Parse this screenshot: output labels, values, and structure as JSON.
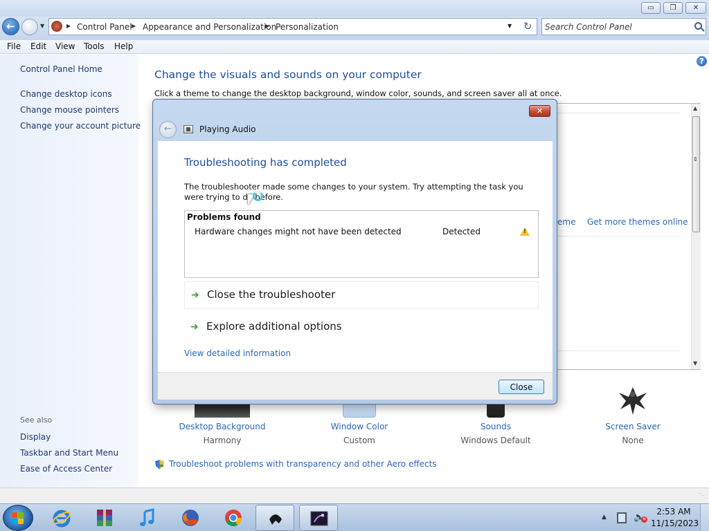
{
  "window": {
    "caption_buttons": {
      "minimize": "▭",
      "maximize": "❐",
      "close": "✕"
    }
  },
  "address": {
    "crumbs": [
      "Control Panel",
      "Appearance and Personalization",
      "Personalization"
    ],
    "search_placeholder": "Search Control Panel"
  },
  "menu": {
    "items": [
      "File",
      "Edit",
      "View",
      "Tools",
      "Help"
    ]
  },
  "left_pane": {
    "home": "Control Panel Home",
    "links": [
      "Change desktop icons",
      "Change mouse pointers",
      "Change your account picture"
    ],
    "see_also_label": "See also",
    "see_also": [
      "Display",
      "Taskbar and Start Menu",
      "Ease of Access Center"
    ]
  },
  "main": {
    "title": "Change the visuals and sounds on your computer",
    "subtitle": "Click a theme to change the desktop background, window color, sounds, and screen saver all at once.",
    "theme_link_partial": "eme",
    "get_more_themes": "Get more themes online",
    "bottom_items": [
      {
        "label": "Desktop Background",
        "value": "Harmony"
      },
      {
        "label": "Window Color",
        "value": "Custom"
      },
      {
        "label": "Sounds",
        "value": "Windows Default"
      },
      {
        "label": "Screen Saver",
        "value": "None"
      }
    ],
    "aero_link": "Troubleshoot problems with transparency and other Aero effects"
  },
  "dialog": {
    "title": "Playing Audio",
    "heading": "Troubleshooting has completed",
    "description": "The troubleshooter made some changes to your system. Try attempting the task you were trying to do before.",
    "problems_header": "Problems found",
    "problems": [
      {
        "name": "Hardware changes might not have been detected",
        "status": "Detected",
        "icon": "warning-icon"
      }
    ],
    "commands": [
      "Close the troubleshooter",
      "Explore additional options"
    ],
    "detail_link": "View detailed information",
    "close_button": "Close"
  },
  "taskbar": {
    "apps": [
      "internet-explorer-icon",
      "winrar-icon",
      "itunes-icon",
      "firefox-icon",
      "chrome-icon",
      "inkscape-icon",
      "screensaver-window-icon"
    ],
    "clock_time": "2:53 AM",
    "clock_date": "11/15/2023"
  },
  "colors": {
    "link": "#2a67b8",
    "heading": "#1e4d9a",
    "command_arrow": "#2ea82e",
    "warning": "#f2c12e"
  }
}
